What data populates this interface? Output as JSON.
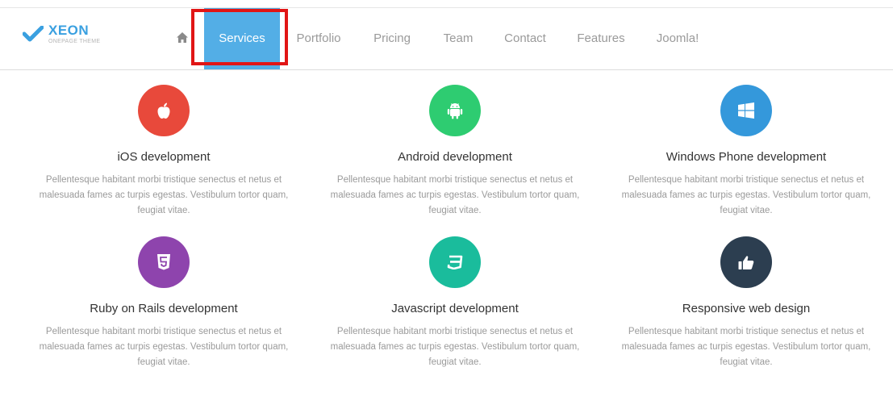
{
  "brand": {
    "name": "XEON",
    "tagline": "ONEPAGE THEME",
    "accent": "#3aa0e0"
  },
  "nav": {
    "home_icon": "home-icon",
    "items": [
      {
        "label": "Services",
        "active": true
      },
      {
        "label": "Portfolio",
        "active": false
      },
      {
        "label": "Pricing",
        "active": false
      },
      {
        "label": "Team",
        "active": false
      },
      {
        "label": "Contact",
        "active": false
      },
      {
        "label": "Features",
        "active": false
      },
      {
        "label": "Joomla!",
        "active": false
      }
    ],
    "active_color": "#53aee6",
    "highlight_color": "#e11515"
  },
  "services": [
    {
      "title": "iOS development",
      "icon": "apple-icon",
      "color": "#e8493b",
      "desc": "Pellentesque habitant morbi tristique senectus et netus et malesuada fames ac turpis egestas. Vestibulum tortor quam, feugiat vitae."
    },
    {
      "title": "Android development",
      "icon": "android-icon",
      "color": "#2ecc71",
      "desc": "Pellentesque habitant morbi tristique senectus et netus et malesuada fames ac turpis egestas. Vestibulum tortor quam, feugiat vitae."
    },
    {
      "title": "Windows Phone development",
      "icon": "windows-icon",
      "color": "#3498db",
      "desc": "Pellentesque habitant morbi tristique senectus et netus et malesuada fames ac turpis egestas. Vestibulum tortor quam, feugiat vitae."
    },
    {
      "title": "Ruby on Rails development",
      "icon": "html5-icon",
      "color": "#8e44ad",
      "desc": "Pellentesque habitant morbi tristique senectus et netus et malesuada fames ac turpis egestas. Vestibulum tortor quam, feugiat vitae."
    },
    {
      "title": "Javascript development",
      "icon": "css3-icon",
      "color": "#1abc9c",
      "desc": "Pellentesque habitant morbi tristique senectus et netus et malesuada fames ac turpis egestas. Vestibulum tortor quam, feugiat vitae."
    },
    {
      "title": "Responsive web design",
      "icon": "thumbs-up-icon",
      "color": "#2c3e50",
      "desc": "Pellentesque habitant morbi tristique senectus et netus et malesuada fames ac turpis egestas. Vestibulum tortor quam, feugiat vitae."
    }
  ]
}
